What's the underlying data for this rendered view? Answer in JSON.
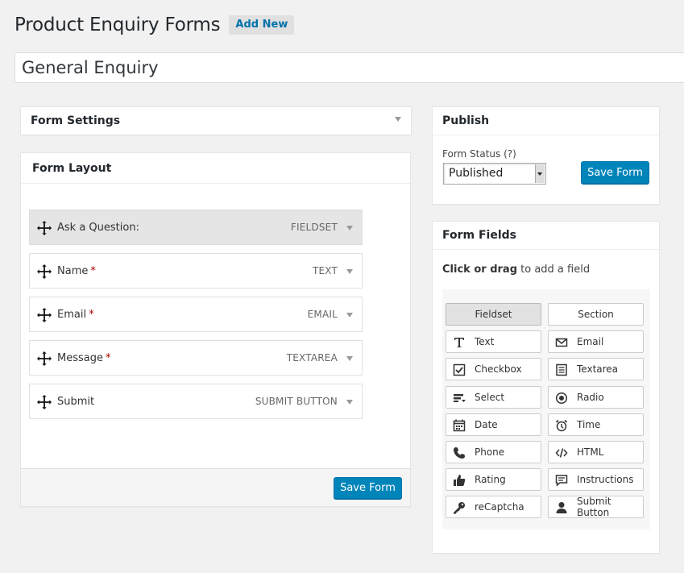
{
  "page": {
    "title": "Product Enquiry Forms",
    "add_new": "Add New"
  },
  "form_title": "General Enquiry",
  "settings_box": {
    "title": "Form Settings"
  },
  "layout_box": {
    "title": "Form Layout",
    "fields": [
      {
        "label": "Ask a Question:",
        "required": false,
        "type": "FIELDSET"
      },
      {
        "label": "Name",
        "required": true,
        "type": "TEXT"
      },
      {
        "label": "Email",
        "required": true,
        "type": "EMAIL"
      },
      {
        "label": "Message",
        "required": true,
        "type": "TEXTAREA"
      },
      {
        "label": "Submit",
        "required": false,
        "type": "SUBMIT BUTTON"
      }
    ],
    "required_marker": "*",
    "save_label": "Save Form"
  },
  "publish_box": {
    "title": "Publish",
    "status_label": "Form Status (?)",
    "status_value": "Published",
    "save_label": "Save Form"
  },
  "fields_box": {
    "title": "Form Fields",
    "hint_bold": "Click or drag",
    "hint_rest": " to add a field",
    "buttons": [
      {
        "label": "Fieldset",
        "icon": "none"
      },
      {
        "label": "Section",
        "icon": "none"
      },
      {
        "label": "Text",
        "icon": "text-icon"
      },
      {
        "label": "Email",
        "icon": "envelope-icon"
      },
      {
        "label": "Checkbox",
        "icon": "checkbox-icon"
      },
      {
        "label": "Textarea",
        "icon": "textarea-icon"
      },
      {
        "label": "Select",
        "icon": "select-icon"
      },
      {
        "label": "Radio",
        "icon": "radio-icon"
      },
      {
        "label": "Date",
        "icon": "calendar-icon"
      },
      {
        "label": "Time",
        "icon": "alarm-clock-icon"
      },
      {
        "label": "Phone",
        "icon": "phone-icon"
      },
      {
        "label": "HTML",
        "icon": "code-icon"
      },
      {
        "label": "Rating",
        "icon": "thumbs-up-icon"
      },
      {
        "label": "Instructions",
        "icon": "comment-icon"
      },
      {
        "label": "reCaptcha",
        "icon": "key-icon"
      },
      {
        "label": "Submit Button",
        "icon": "user-icon"
      }
    ]
  },
  "colors": {
    "primary": "#0085ba",
    "link": "#0073aa",
    "required": "#aa0000"
  }
}
